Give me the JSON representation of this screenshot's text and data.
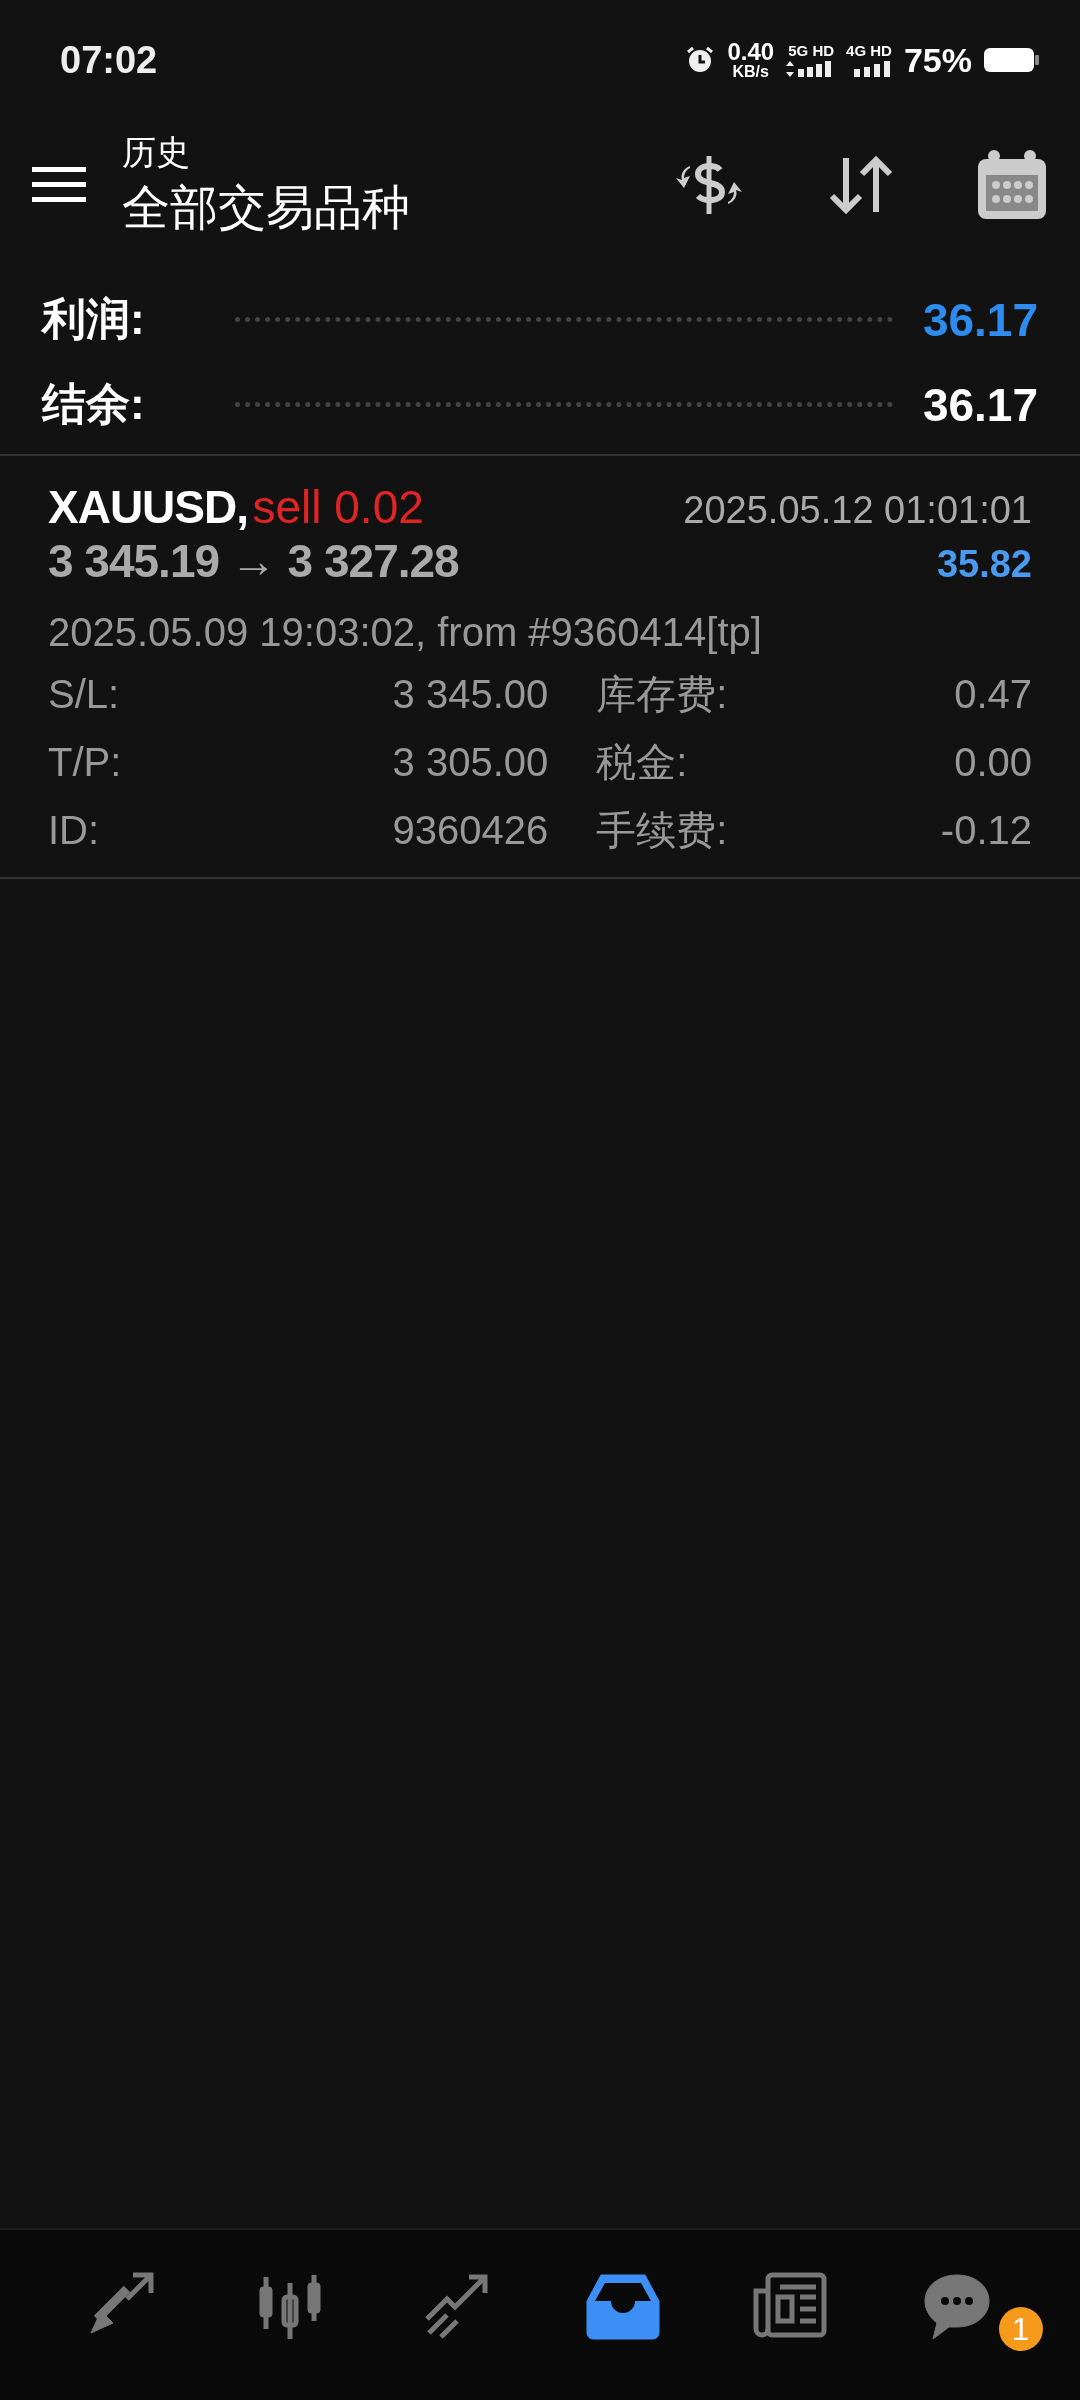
{
  "status_bar": {
    "time": "07:02",
    "net_speed": "0.40",
    "net_unit": "KB/s",
    "sim_1": "5G HD",
    "sim_2": "4G HD",
    "battery": "75%"
  },
  "header": {
    "subtitle": "历史",
    "title": "全部交易品种"
  },
  "summary": [
    {
      "kind": "profit",
      "label": "利润:",
      "value": "36.17"
    },
    {
      "kind": "balance",
      "label": "结余:",
      "value": "36.17"
    }
  ],
  "trade": {
    "symbol": "XAUUSD,",
    "side": "sell 0.02",
    "close_time": "2025.05.12 01:01:01",
    "prices": "3 345.19 → 3 327.28",
    "profit": "35.82",
    "open_info": "2025.05.09 19:03:02, from #9360414[tp]",
    "details": [
      {
        "label": "S/L:",
        "value": "3 345.00",
        "label_2": "库存费:",
        "value_2": "0.47"
      },
      {
        "label": "T/P:",
        "value": "3 305.00",
        "label_2": "税金:",
        "value_2": "0.00"
      },
      {
        "label": "ID:",
        "value": "9360426",
        "label_2": "手续费:",
        "value_2": "-0.12"
      }
    ]
  },
  "nav": [
    {
      "selected": false
    },
    {
      "selected": false
    },
    {
      "selected": false
    },
    {
      "selected": true
    },
    {
      "selected": false
    },
    {
      "selected": false,
      "badge": "1"
    }
  ]
}
